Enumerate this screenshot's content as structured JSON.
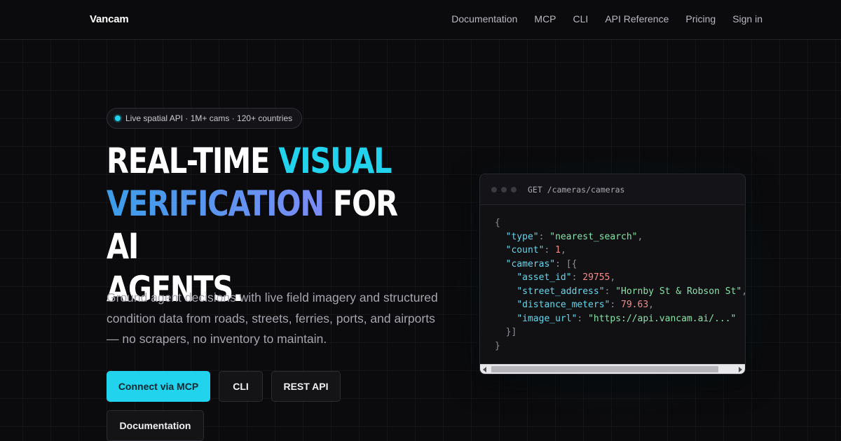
{
  "nav": {
    "brand": "Vancam",
    "links": [
      "Documentation",
      "MCP",
      "CLI",
      "API Reference",
      "Pricing",
      "Sign in"
    ]
  },
  "hero": {
    "pill": "Live spatial API · 1M+ cams · 120+ countries",
    "headline": {
      "part1": "REAL-TIME ",
      "part2_cyan": "VISUAL",
      "part3_gradient": "VERIFICATION",
      "part4": " FOR AI",
      "part5": "AGENTS."
    },
    "subtitle": "Ground agent decisions with live field imagery and structured condition data from roads, streets, ferries, ports, and airports — no scrapers, no inventory to maintain.",
    "buttons": {
      "primary": "Connect via MCP",
      "cli": "CLI",
      "rest": "REST API",
      "docs": "Documentation"
    }
  },
  "code": {
    "title": "GET /cameras/cameras",
    "type_value": "\"nearest_search\"",
    "count_value": "1",
    "asset_id_value": "29755",
    "street_address_value": "\"Hornby St & Robson St\"",
    "distance_meters_value": "79.63",
    "image_url_value": "\"https://api.vancam.ai/...\""
  },
  "colors": {
    "accent": "#22d3ee",
    "background": "#0b0b0d",
    "gradient_start": "#3b9dea",
    "gradient_end": "#7b8cf6"
  }
}
